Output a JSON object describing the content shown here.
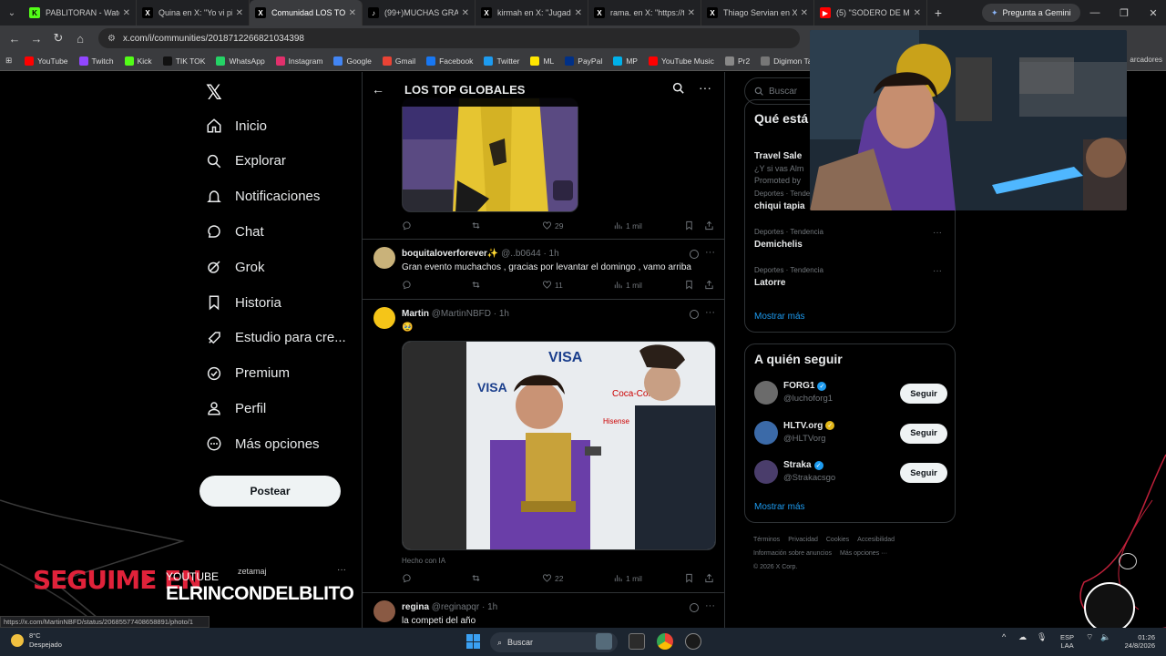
{
  "browser": {
    "tabs": [
      {
        "title": "PABLITORAN - Watch",
        "fav_color": "#53fc18",
        "fav_glyph": "K",
        "active": false
      },
      {
        "title": "Quina en X: \"Yo vi pir",
        "fav_color": "#000000",
        "fav_glyph": "X",
        "active": false
      },
      {
        "title": "Comunidad LOS TOP",
        "fav_color": "#000000",
        "fav_glyph": "X",
        "active": true
      },
      {
        "title": "(99+)MUCHAS GRAC",
        "fav_color": "#000000",
        "fav_glyph": "♪",
        "active": false
      },
      {
        "title": "kirmah en X: \"Jugada",
        "fav_color": "#000000",
        "fav_glyph": "X",
        "active": false
      },
      {
        "title": "rama. en X: \"https://t",
        "fav_color": "#000000",
        "fav_glyph": "X",
        "active": false
      },
      {
        "title": "Thiago Servian en X",
        "fav_color": "#000000",
        "fav_glyph": "X",
        "active": false
      },
      {
        "title": "(5) \"SODERO DE MI V",
        "fav_color": "#ff0000",
        "fav_glyph": "▶",
        "active": false
      }
    ],
    "gemini_label": "Pregunta a Gemini",
    "url": "x.com/i/communities/2018712266821034398",
    "bookmarks": [
      {
        "label": "YouTube",
        "color": "#ff0000"
      },
      {
        "label": "Twitch",
        "color": "#9146ff"
      },
      {
        "label": "Kick",
        "color": "#53fc18"
      },
      {
        "label": "TIK TOK",
        "color": "#111111"
      },
      {
        "label": "WhatsApp",
        "color": "#25d366"
      },
      {
        "label": "Instagram",
        "color": "#e1306c"
      },
      {
        "label": "Google",
        "color": "#4285f4"
      },
      {
        "label": "Gmail",
        "color": "#ea4335"
      },
      {
        "label": "Facebook",
        "color": "#1877f2"
      },
      {
        "label": "Twitter",
        "color": "#1d9bf0"
      },
      {
        "label": "ML",
        "color": "#ffe600"
      },
      {
        "label": "PayPal",
        "color": "#003087"
      },
      {
        "label": "MP",
        "color": "#00b1ea"
      },
      {
        "label": "YouTube Music",
        "color": "#ff0000"
      },
      {
        "label": "Pr2",
        "color": "#888888"
      },
      {
        "label": "Digimon Tamers - a",
        "color": "#777777"
      }
    ],
    "bookmarks_right": "arcadores",
    "status_url": "https://x.com/MartinNBFD/status/20685577408658891/photo/1"
  },
  "nav": {
    "items": [
      {
        "label": "Inicio",
        "icon": "home-icon"
      },
      {
        "label": "Explorar",
        "icon": "search-icon"
      },
      {
        "label": "Notificaciones",
        "icon": "bell-icon"
      },
      {
        "label": "Chat",
        "icon": "chat-icon"
      },
      {
        "label": "Grok",
        "icon": "grok-icon"
      },
      {
        "label": "Historia",
        "icon": "bookmark-icon"
      },
      {
        "label": "Estudio para cre...",
        "icon": "rocket-icon"
      },
      {
        "label": "Premium",
        "icon": "premium-icon"
      },
      {
        "label": "Perfil",
        "icon": "person-icon"
      },
      {
        "label": "Más opciones",
        "icon": "more-icon"
      }
    ],
    "post_button": "Postear"
  },
  "timeline": {
    "title": "LOS TOP GLOBALES",
    "first_post_actions": {
      "likes": "29",
      "views": "1 mil"
    },
    "posts": [
      {
        "name": "boquitaloverforever✨",
        "handle": "@..b0644",
        "time": "· 1h",
        "text": "Gran evento muchachos , gracias por levantar el domingo , vamo arriba",
        "likes": "11",
        "views": "1 mil"
      },
      {
        "name": "Martin",
        "handle": "@MartinNBFD",
        "time": "· 1h",
        "text": "🥹",
        "ai_label": "Hecho con IA",
        "likes": "22",
        "views": "1 mil"
      },
      {
        "name": "regina",
        "handle": "@reginapqr",
        "time": "· 1h",
        "text": "la competi del año"
      }
    ]
  },
  "right": {
    "search_placeholder": "Buscar",
    "trends_title": "Qué está",
    "trends": [
      {
        "category": "",
        "name": "Travel Sale",
        "sub": "¿Y si vas Alm",
        "promo": "Promoted by"
      },
      {
        "category": "Deportes · Tenden",
        "name": "chiqui tapia"
      },
      {
        "category": "Deportes · Tendencia",
        "name": "Demichelis"
      },
      {
        "category": "Deportes · Tendencia",
        "name": "Latorre"
      }
    ],
    "trends_more": "Mostrar más",
    "who_title": "A quién seguir",
    "who": [
      {
        "name": "FORG1",
        "handle": "@luchoforg1",
        "badge_color": "#1d9bf0",
        "button": "Seguir"
      },
      {
        "name": "HLTV.org",
        "handle": "@HLTVorg",
        "badge_color": "#e2b719",
        "button": "Seguir"
      },
      {
        "name": "Straka",
        "handle": "@Strakacsgo",
        "badge_color": "#1d9bf0",
        "button": "Seguir"
      }
    ],
    "who_more": "Mostrar más",
    "footer": [
      "Términos",
      "Privacidad",
      "Cookies",
      "Accesibilidad",
      "Información sobre anuncios",
      "Más opciones ···",
      "© 2026 X Corp."
    ]
  },
  "overlay": {
    "follow_text": "SEGUIME EN",
    "platform": "YOUTUBE",
    "channel": "ELRINCONDELBLITO",
    "chat_user": "zetamaj"
  },
  "taskbar": {
    "temp": "8°C",
    "weather": "Despejado",
    "search": "Buscar",
    "lang1": "ESP",
    "lang2": "LAA",
    "time": "01:26",
    "date": "24/8/2026"
  },
  "colors": {
    "accent": "#1d9bf0",
    "overlay_red": "#e0223a"
  }
}
